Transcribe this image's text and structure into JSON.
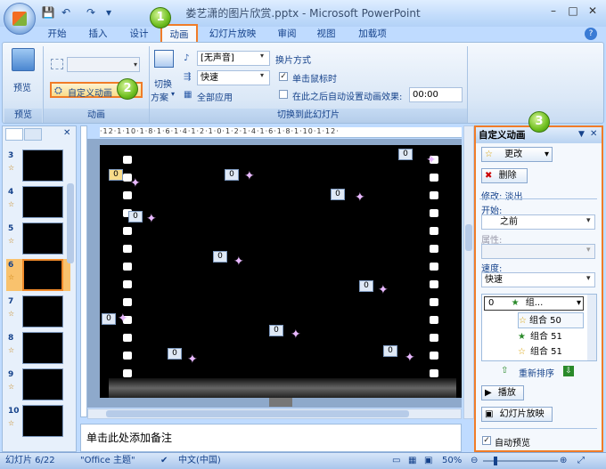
{
  "window": {
    "title": "娄艺潇的图片欣赏.pptx - Microsoft PowerPoint",
    "minimize": "–",
    "maximize": "□",
    "close": "✕",
    "help": "?"
  },
  "qat": {
    "save": "💾",
    "undo": "↶",
    "redo": "↷",
    "more": "▾"
  },
  "tabs": [
    "开始",
    "插入",
    "设计",
    "动画",
    "幻灯片放映",
    "审阅",
    "视图",
    "加载项"
  ],
  "ribbon": {
    "preview_label": "预览",
    "preview_group": "预览",
    "custom_anim": "自定义动画",
    "anim_group": "动画",
    "switch_label": "切换",
    "switch_scheme": "方案",
    "sound_value": "[无声音]",
    "speed_value": "快速",
    "apply_all": "全部应用",
    "advance_title": "换片方式",
    "on_click": "单击鼠标时",
    "auto_after": "在此之后自动设置动画效果:",
    "time_value": "00:00",
    "transition_group": "切换到此幻灯片"
  },
  "badges": [
    "1",
    "2",
    "3"
  ],
  "slides_pane": {
    "tab_close": "✕",
    "thumbnails": [
      {
        "num": "3",
        "star": "☆"
      },
      {
        "num": "4",
        "star": "☆"
      },
      {
        "num": "5",
        "star": "☆"
      },
      {
        "num": "6",
        "star": "☆"
      },
      {
        "num": "7",
        "star": "☆"
      },
      {
        "num": "8",
        "star": "☆"
      },
      {
        "num": "9",
        "star": "☆"
      },
      {
        "num": "10",
        "star": "☆"
      }
    ]
  },
  "ruler_text": "·12·1·10·1·8·1·6·1·4·1·2·1·0·1·2·1·4·1·6·1·8·1·10·1·12·",
  "slide": {
    "tags": [
      "0",
      "0",
      "0",
      "0",
      "0",
      "0",
      "0",
      "0",
      "0",
      "0",
      "0"
    ]
  },
  "notes_placeholder": "单击此处添加备注",
  "task_pane": {
    "title": "自定义动画",
    "change_label": "更改",
    "delete_label": "删除",
    "modify_label": "修改: 淡出",
    "start_label": "开始:",
    "start_value": "之前",
    "property_label": "属性:",
    "speed_label": "速度:",
    "speed_value": "快速",
    "list": [
      {
        "num": "0",
        "name": "组..."
      },
      {
        "num": "",
        "name": "组合 50"
      },
      {
        "num": "",
        "name": "组合 51"
      },
      {
        "num": "",
        "name": "组合 51"
      }
    ],
    "reorder_label": "重新排序",
    "play_label": "播放",
    "slideshow_label": "幻灯片放映",
    "autopreview_label": "自动预览"
  },
  "status": {
    "slide_info": "幻灯片 6/22",
    "theme": "\"Office 主题\"",
    "language": "中文(中国)",
    "zoom": "50%"
  },
  "colors": {
    "highlight": "#f07c28",
    "badge_green": "#6fbf1f"
  }
}
